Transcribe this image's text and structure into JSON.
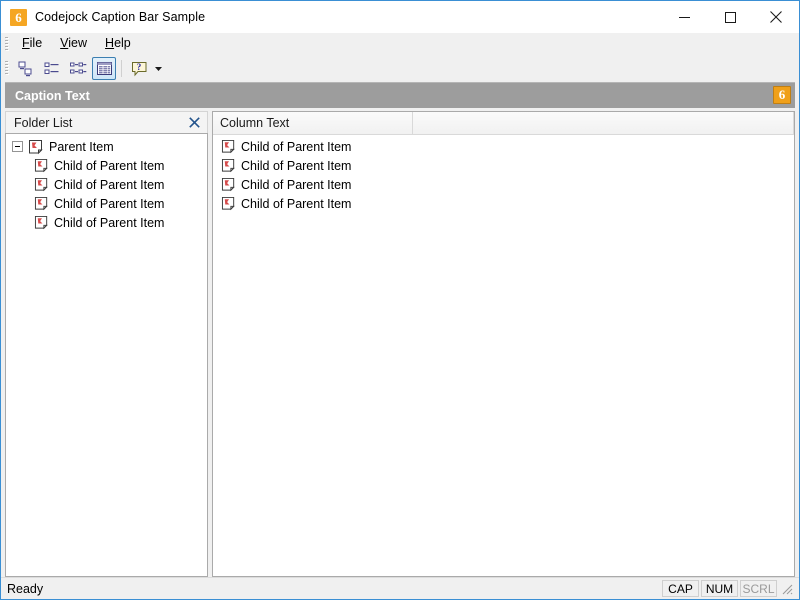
{
  "window": {
    "title": "Codejock Caption Bar Sample",
    "app_icon": "codejock-logo-icon",
    "controls": {
      "minimize": "minimize-icon",
      "maximize": "maximize-icon",
      "close": "close-icon"
    }
  },
  "menubar": {
    "items": [
      {
        "label": "File",
        "accel": "F"
      },
      {
        "label": "View",
        "accel": "V"
      },
      {
        "label": "Help",
        "accel": "H"
      }
    ]
  },
  "toolbar": {
    "buttons": [
      {
        "name": "large-icons-view-button",
        "checked": false
      },
      {
        "name": "small-icons-view-button",
        "checked": false
      },
      {
        "name": "list-view-button",
        "checked": false
      },
      {
        "name": "details-view-button",
        "checked": true
      },
      {
        "name": "help-button",
        "checked": false
      }
    ],
    "overflow": "toolbar-overflow-chevron"
  },
  "caption_bar": {
    "text": "Caption Text",
    "icon": "codejock-logo-icon",
    "background_color": "#9d9d9d",
    "text_color": "#ffffff"
  },
  "tree_pane": {
    "title": "Folder List",
    "close_label": "✕",
    "root": {
      "label": "Parent Item",
      "expanded": true
    },
    "children": [
      {
        "label": "Child of Parent Item"
      },
      {
        "label": "Child of Parent Item"
      },
      {
        "label": "Child of Parent Item"
      },
      {
        "label": "Child of Parent Item"
      }
    ]
  },
  "list_pane": {
    "columns": [
      {
        "label": "Column Text"
      },
      {
        "label": ""
      }
    ],
    "rows": [
      {
        "label": "Child of Parent Item"
      },
      {
        "label": "Child of Parent Item"
      },
      {
        "label": "Child of Parent Item"
      },
      {
        "label": "Child of Parent Item"
      }
    ]
  },
  "statusbar": {
    "message": "Ready",
    "panels": [
      {
        "label": "CAP",
        "active": true
      },
      {
        "label": "NUM",
        "active": true
      },
      {
        "label": "SCRL",
        "active": false
      }
    ],
    "grip": "resize-grip-icon"
  }
}
